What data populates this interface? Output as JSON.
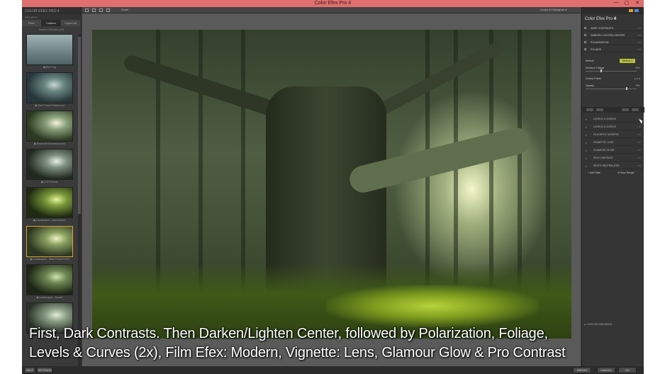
{
  "window": {
    "title": "Color Efex Pro 4",
    "controls": [
      "—",
      "▢",
      "✕"
    ]
  },
  "left_panel": {
    "brand": "COLOR EFEX PRO 4",
    "section_label": "RECIPES",
    "tabs": [
      {
        "label": "Filter",
        "active": false
      },
      {
        "label": "Custom",
        "active": true
      },
      {
        "label": "Import All",
        "active": false
      }
    ],
    "search_label": "Search Results (44)",
    "presets": [
      {
        "name": "▣ Blue Fog",
        "selected": false
      },
      {
        "name": "▣ Dark Forest Portamount",
        "selected": false
      },
      {
        "name": "▣ Botanical Illuminationwork",
        "selected": false
      },
      {
        "name": "▣ LOTR Bekah",
        "selected": false
      },
      {
        "name": "▣ Landscapes - Dark Autumn",
        "selected": false
      },
      {
        "name": "▣ Landscapes - Misty Forest Fetch",
        "selected": true
      },
      {
        "name": "▣ Landscapes - Sunset",
        "selected": false
      },
      {
        "name": "▣ Shadow",
        "selected": false
      }
    ],
    "bottom_buttons": [
      "HELP",
      "SETTINGS"
    ]
  },
  "toolbar": {
    "zoom_label": "Zoom",
    "compare_label": "Loupe & Histogram ▾"
  },
  "caption": {
    "line1": "First, Dark Contrasts. Then Darken/Lighten Center, followed by Polarization, Foliage,",
    "line2": "Levels & Curves (2x), Film Efex: Modern, Vignette: Lens, Glamour Glow & Pro Contrast"
  },
  "right_panel": {
    "product_prefix": "Color Efex Pro",
    "product_version": "4",
    "active_filters": [
      {
        "name": "DARK CONTRASTS",
        "controls": "▪ ✕"
      },
      {
        "name": "DARKEN / LIGHTEN CENTER",
        "controls": "▪ ✕"
      },
      {
        "name": "POLARIZATION",
        "controls": "▪ ✕"
      },
      {
        "name": "FOLIAGE",
        "controls": "▪ ✕"
      }
    ],
    "foliage_params": {
      "method_label": "Method",
      "method_value": "Method 2",
      "enhance_label": "Enhance Foliage",
      "enhance_value": "29%",
      "enhance_fraction": 0.29,
      "control_points_label": "Control Points",
      "opacity_label": "Opacity",
      "opacity_value": "79%",
      "opacity_fraction": 0.79
    },
    "stack_filters": [
      {
        "name": "LEVELS & CURVES",
        "controls": "▪ ✕"
      },
      {
        "name": "LEVELS & CURVES",
        "controls": "▪ ✕"
      },
      {
        "name": "FILM EFEX: MODERN",
        "controls": "▪ ✕"
      },
      {
        "name": "VIGNETTE: LENS",
        "controls": "▪ ✕"
      },
      {
        "name": "GLAMOUR GLOW",
        "controls": "▪ ✕"
      },
      {
        "name": "PRO CONTRAST",
        "controls": "▪ ✕"
      },
      {
        "name": "WHITE NEUTRALIZER",
        "controls": "▪ ✕"
      }
    ],
    "add_filter_label": "+ Add Filter",
    "save_recipe_label": "⟲ Save Recipe",
    "history_label": "▸ ▪ HISTORY BROWSER",
    "accent_color": "#d9a42a",
    "method_color": "#b9c23a"
  },
  "bottom_buttons": [
    "BRUSH",
    "CANCEL",
    "OK"
  ]
}
